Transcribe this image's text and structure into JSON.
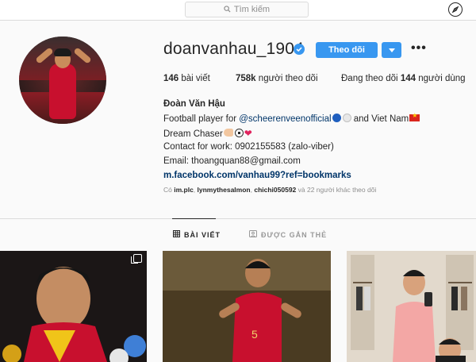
{
  "search": {
    "placeholder": "Tìm kiếm"
  },
  "profile": {
    "username": "doanvanhau_1904",
    "follow_label": "Theo dõi",
    "more_label": "•••"
  },
  "stats": {
    "posts_count": "146",
    "posts_label": "bài viết",
    "followers_count": "758k",
    "followers_label": "người theo dõi",
    "following_prefix": "Đang theo dõi",
    "following_count": "144",
    "following_label": "người dùng"
  },
  "bio": {
    "name": "Đoàn Văn Hậu",
    "line1_prefix": "Football player for ",
    "line1_mention": "@scheerenveenofficial",
    "line1_suffix": " and Viet Nam",
    "line2": "Dream Chaser",
    "line3": "Contact for work: 0902155583 (zalo-viber)",
    "line4": "Email: thoangquan88@gmail.com",
    "link": "m.facebook.com/vanhau99?ref=bookmarks"
  },
  "followed_by": {
    "prefix": "Có ",
    "user1": "im.plc",
    "sep1": ", ",
    "user2": "lynmythesalmon",
    "sep2": ", ",
    "user3": "chichi050592",
    "suffix": " và 22 người khác theo dõi"
  },
  "tabs": [
    {
      "label": "BÀI VIẾT",
      "icon": "grid-icon",
      "active": true
    },
    {
      "label": "ĐƯỢC GẮN THẺ",
      "icon": "tag-icon",
      "active": false
    }
  ],
  "colors": {
    "accent": "#3897f0",
    "text": "#262626",
    "muted": "#8e8e8e",
    "link": "#003569",
    "background": "#fafafa"
  },
  "icons": {
    "search": "search-icon",
    "explore": "compass-icon",
    "verified": "verified-badge-icon",
    "dropdown": "chevron-down-icon",
    "multi_post": "carousel-icon"
  }
}
